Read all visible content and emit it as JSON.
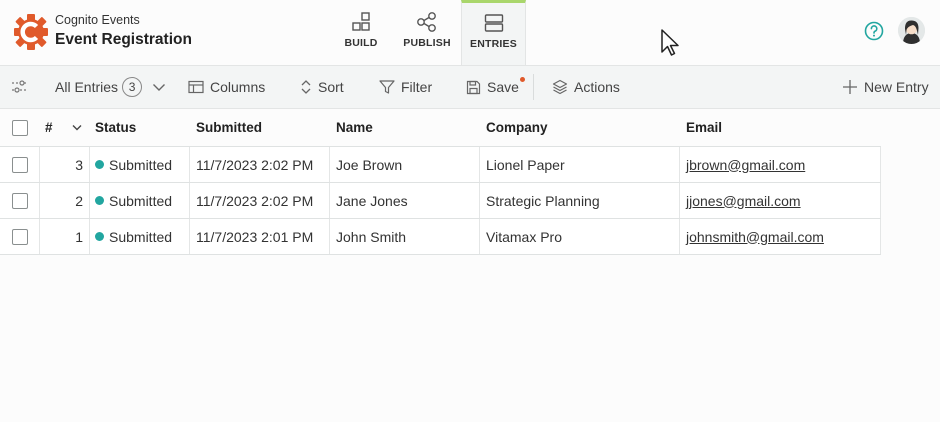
{
  "app": {
    "subtitle": "Cognito Events",
    "title": "Event Registration"
  },
  "nav": {
    "tabs": [
      {
        "label": "BUILD",
        "icon": "build-icon"
      },
      {
        "label": "PUBLISH",
        "icon": "publish-icon"
      },
      {
        "label": "ENTRIES",
        "icon": "entries-icon",
        "active": true
      }
    ]
  },
  "toolbar": {
    "view_label": "All Entries",
    "view_count": "3",
    "columns_label": "Columns",
    "sort_label": "Sort",
    "filter_label": "Filter",
    "save_label": "Save",
    "actions_label": "Actions",
    "new_entry_label": "New Entry"
  },
  "table": {
    "headers": {
      "num": "#",
      "status": "Status",
      "submitted": "Submitted",
      "name": "Name",
      "company": "Company",
      "email": "Email"
    },
    "rows": [
      {
        "num": "3",
        "status": "Submitted",
        "submitted": "11/7/2023 2:02 PM",
        "name": "Joe Brown",
        "company": "Lionel Paper",
        "email": "jbrown@gmail.com"
      },
      {
        "num": "2",
        "status": "Submitted",
        "submitted": "11/7/2023 2:02 PM",
        "name": "Jane Jones",
        "company": "Strategic Planning",
        "email": "jjones@gmail.com"
      },
      {
        "num": "1",
        "status": "Submitted",
        "submitted": "11/7/2023 2:01 PM",
        "name": "John Smith",
        "company": "Vitamax Pro",
        "email": "johnsmith@gmail.com"
      }
    ]
  },
  "colors": {
    "brand": "#e05a2b",
    "accent": "#22a6a0",
    "active_tab": "#a9d66b",
    "status_submitted": "#22a6a0"
  }
}
